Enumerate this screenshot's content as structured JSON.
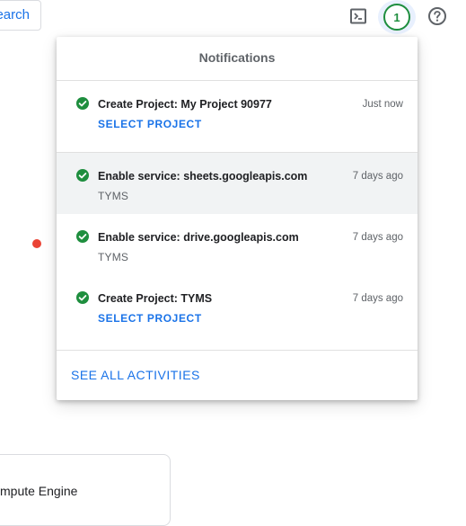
{
  "topbar": {
    "search_label": "earch",
    "notification_count": "1"
  },
  "background": {
    "card_label": "mpute Engine"
  },
  "notifications": {
    "title": "Notifications",
    "items": [
      {
        "title": "Create Project: My Project 90977",
        "time": "Just now",
        "action": "SELECT PROJECT"
      },
      {
        "title": "Enable service: sheets.googleapis.com",
        "time": "7 days ago",
        "subtitle": "TYMS"
      },
      {
        "title": "Enable service: drive.googleapis.com",
        "time": "7 days ago",
        "subtitle": "TYMS"
      },
      {
        "title": "Create Project: TYMS",
        "time": "7 days ago",
        "action": "SELECT PROJECT"
      }
    ],
    "see_all_label": "SEE ALL ACTIVITIES"
  },
  "colors": {
    "success_green": "#1e8e3e",
    "link_blue": "#1a73e8",
    "hover_gray": "#f1f3f4"
  },
  "icons": [
    "terminal-icon",
    "notifications-icon",
    "help-icon",
    "check-circle-icon"
  ]
}
